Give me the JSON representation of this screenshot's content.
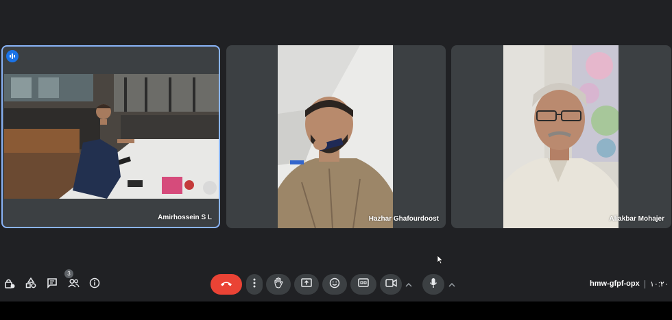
{
  "participants": [
    {
      "name": "Amirhossein S L",
      "speaking": true
    },
    {
      "name": "Hazhar Ghafourdoost",
      "speaking": false
    },
    {
      "name": "Aliakbar Mohajer",
      "speaking": false
    }
  ],
  "toolbar": {
    "people_count": "3",
    "meeting_code": "hmw-gfpf-opx",
    "clock": "۱۰:۲۰"
  },
  "icons": {
    "host_controls": "lock-person-icon",
    "activities": "shapes-icon",
    "chat": "chat-icon",
    "people": "people-icon",
    "info": "info-icon",
    "leave_call": "phone-hangup-icon",
    "more": "more-vert-icon",
    "raise_hand": "hand-icon",
    "present": "present-screen-icon",
    "reactions": "emoji-icon",
    "captions": "cc-icon",
    "camera": "videocam-icon",
    "microphone": "mic-icon"
  },
  "colors": {
    "background": "#202124",
    "tile": "#3c4043",
    "active_speaker_border": "#8ab4f8",
    "leave_button": "#ea4335",
    "speaking_badge": "#1a73e8"
  }
}
